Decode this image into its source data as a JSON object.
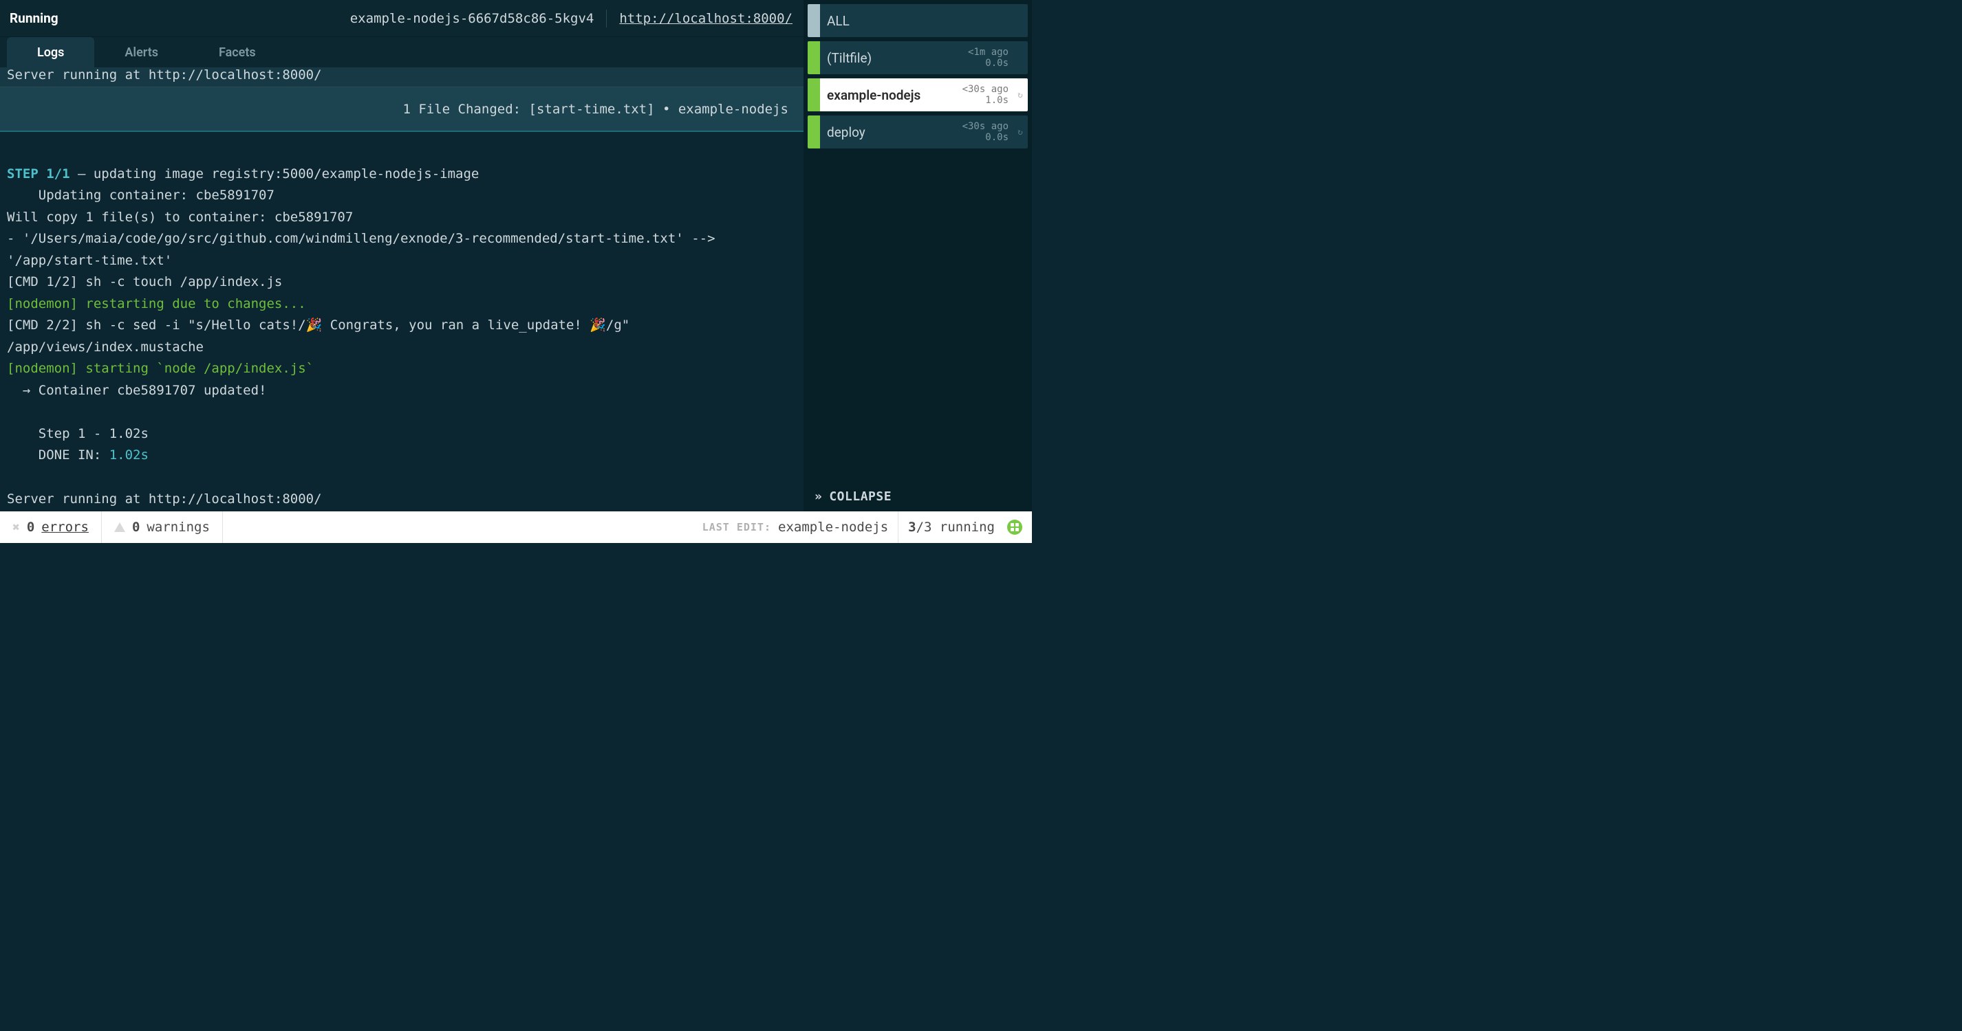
{
  "header": {
    "status": "Running",
    "pod": "example-nodejs-6667d58c86-5kgv4",
    "url": "http://localhost:8000/"
  },
  "tabs": {
    "logs": "Logs",
    "alerts": "Alerts",
    "facets": "Facets"
  },
  "scrolled_line": "Server running at http://localhost:8000/",
  "banner": "1 File Changed: [start-time.txt] • example-nodejs",
  "log": {
    "step_label": "STEP 1/1",
    "step_rest": " — updating image registry:5000/example-nodejs-image",
    "l2": "    Updating container: cbe5891707",
    "l3": "Will copy 1 file(s) to container: cbe5891707",
    "l4": "- '/Users/maia/code/go/src/github.com/windmilleng/exnode/3-recommended/start-time.txt' --> '/app/start-time.txt'",
    "l5": "[CMD 1/2] sh -c touch /app/index.js",
    "l6": "[nodemon] restarting due to changes...",
    "l7": "[CMD 2/2] sh -c sed -i \"s/Hello cats!/🎉 Congrats, you ran a live_update! 🎉/g\" /app/views/index.mustache",
    "l8": "[nodemon] starting `node /app/index.js`",
    "l9": "  → Container cbe5891707 updated!",
    "l10": "",
    "l11": "    Step 1 - 1.02s",
    "l12a": "    DONE IN: ",
    "l12b": "1.02s",
    "l13": "",
    "l14": "Server running at http://localhost:8000/"
  },
  "sidebar": {
    "all": "ALL",
    "items": [
      {
        "name": "(Tiltfile)",
        "ago": "<1m ago",
        "dur": "0.0s"
      },
      {
        "name": "example-nodejs",
        "ago": "<30s ago",
        "dur": "1.0s"
      },
      {
        "name": "deploy",
        "ago": "<30s ago",
        "dur": "0.0s"
      }
    ],
    "collapse": "COLLAPSE"
  },
  "footer": {
    "errors_count": "0",
    "errors_label": "errors",
    "warnings_count": "0",
    "warnings_label": "warnings",
    "last_edit_label": "LAST EDIT:",
    "last_edit_value": "example-nodejs",
    "running_num": "3",
    "running_total": "/3 running"
  }
}
